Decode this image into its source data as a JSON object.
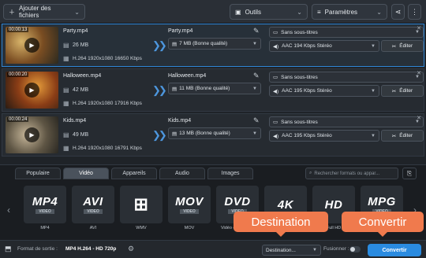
{
  "toolbar": {
    "add_files": "Ajouter des fichiers",
    "tools": "Outils",
    "settings": "Paramètres"
  },
  "files": [
    {
      "duration": "00:00:13",
      "name": "Party.mp4",
      "size": "26 MB",
      "info": "H.264 1920x1080 16650 Kbps",
      "output_name": "Party.mp4",
      "output_size": "7 MB (Bonne qualité)",
      "subtitles": "Sans sous-titres",
      "audio": "AAC 194 Kbps Stéréo",
      "edit": "Éditer"
    },
    {
      "duration": "00:00:20",
      "name": "Halloween.mp4",
      "size": "42 MB",
      "info": "H.264 1920x1080 17916 Kbps",
      "output_name": "Halloween.mp4",
      "output_size": "11 MB (Bonne qualité)",
      "subtitles": "Sans sous-titres",
      "audio": "AAC 195 Kbps Stéréo",
      "edit": "Éditer"
    },
    {
      "duration": "00:00:24",
      "name": "Kids.mp4",
      "size": "49 MB",
      "info": "H.264 1920x1080 16791 Kbps",
      "output_name": "Kids.mp4",
      "output_size": "13 MB (Bonne qualité)",
      "subtitles": "Sans sous-titres",
      "audio": "AAC 195 Kbps Stéréo",
      "edit": "Éditer"
    }
  ],
  "tabs": [
    "Populaire",
    "Vidéo",
    "Appareils",
    "Audio",
    "Images"
  ],
  "search_placeholder": "Rechercher formats ou appar...",
  "formats": [
    {
      "big": "MP4",
      "small": "VIDEO",
      "label": "MP4"
    },
    {
      "big": "AVI",
      "small": "VIDEO",
      "label": "AVI"
    },
    {
      "big": "⊞",
      "small": "",
      "label": "WMV"
    },
    {
      "big": "MOV",
      "small": "VIDEO",
      "label": "MOV"
    },
    {
      "big": "DVD",
      "small": "VIDEO",
      "label": "Vidéo compatible"
    },
    {
      "big": "4K",
      "small": "",
      "label": ""
    },
    {
      "big": "HD",
      "small": "",
      "label": "Full HD"
    },
    {
      "big": "MPG",
      "small": "VIDEO",
      "label": ""
    }
  ],
  "status": {
    "format_label": "Format de sortie :",
    "format_value": "MP4 H.264 - HD 720p",
    "destination": "Destination...",
    "merge": "Fusionner :",
    "convert": "Convertir"
  },
  "callouts": {
    "destination": "Destination",
    "convert": "Convertir"
  }
}
